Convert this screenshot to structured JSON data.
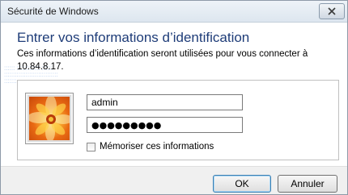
{
  "window": {
    "title": "Sécurité de Windows",
    "close_icon": "close-icon"
  },
  "dialog": {
    "heading": "Entrer vos informations d’identification",
    "description": "Ces informations d’identification seront utilisées pour vous connecter à 10.84.8.17."
  },
  "credentials": {
    "user_tile_icon": "user-tile-flower-icon",
    "username_value": "admin",
    "password_value": "●●●●●●●●●",
    "remember_label": "Mémoriser ces informations",
    "remember_checked": false
  },
  "buttons": {
    "ok_label": "OK",
    "cancel_label": "Annuler"
  },
  "colors": {
    "heading": "#1e3c78",
    "default_button_border": "#3c7fb1"
  }
}
